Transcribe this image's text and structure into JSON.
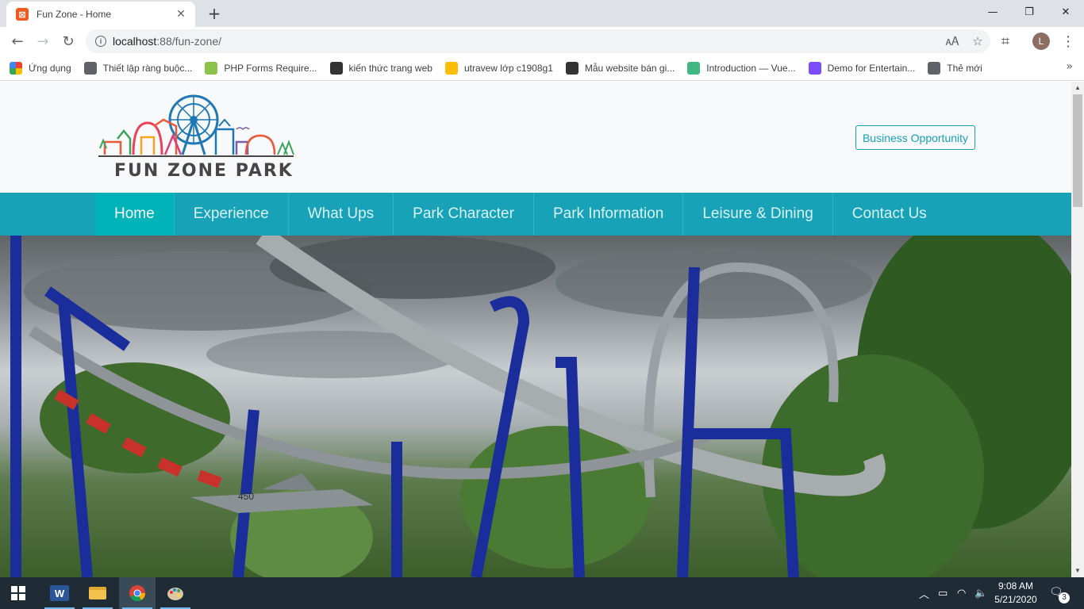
{
  "browser": {
    "tab_title": "Fun Zone - Home",
    "url_host": "localhost",
    "url_rest": ":88/fun-zone/",
    "profile_initial": "L",
    "bookmarks": [
      {
        "label": "Ứng dụng",
        "color": "#ea4335"
      },
      {
        "label": "Thiết lập ràng buộc...",
        "color": "#5f6368"
      },
      {
        "label": "PHP Forms Require...",
        "color": "#8bc34a"
      },
      {
        "label": "kiến thức trang web",
        "color": "#333333"
      },
      {
        "label": "utravew lớp c1908g1",
        "color": "#fbbc04"
      },
      {
        "label": "Mẫu website bán gi...",
        "color": "#333333"
      },
      {
        "label": "Introduction — Vue...",
        "color": "#41b883"
      },
      {
        "label": "Demo for Entertain...",
        "color": "#7c4dff"
      },
      {
        "label": "Thẻ mới",
        "color": "#5f6368"
      }
    ]
  },
  "site": {
    "logo_text": "FUN ZONE PARK",
    "business_button": "Business Opportunity",
    "nav": [
      "Home",
      "Experience",
      "What Ups",
      "Park Character",
      "Park Information",
      "Leisure & Dining",
      "Contact Us"
    ],
    "active_nav": "Home",
    "colors": {
      "nav_bg": "#17a2b8",
      "nav_active": "#00b3b8",
      "header_bg": "#f8f9fa"
    }
  },
  "taskbar": {
    "time": "9:08 AM",
    "date": "5/21/2020",
    "notification_count": "3"
  }
}
